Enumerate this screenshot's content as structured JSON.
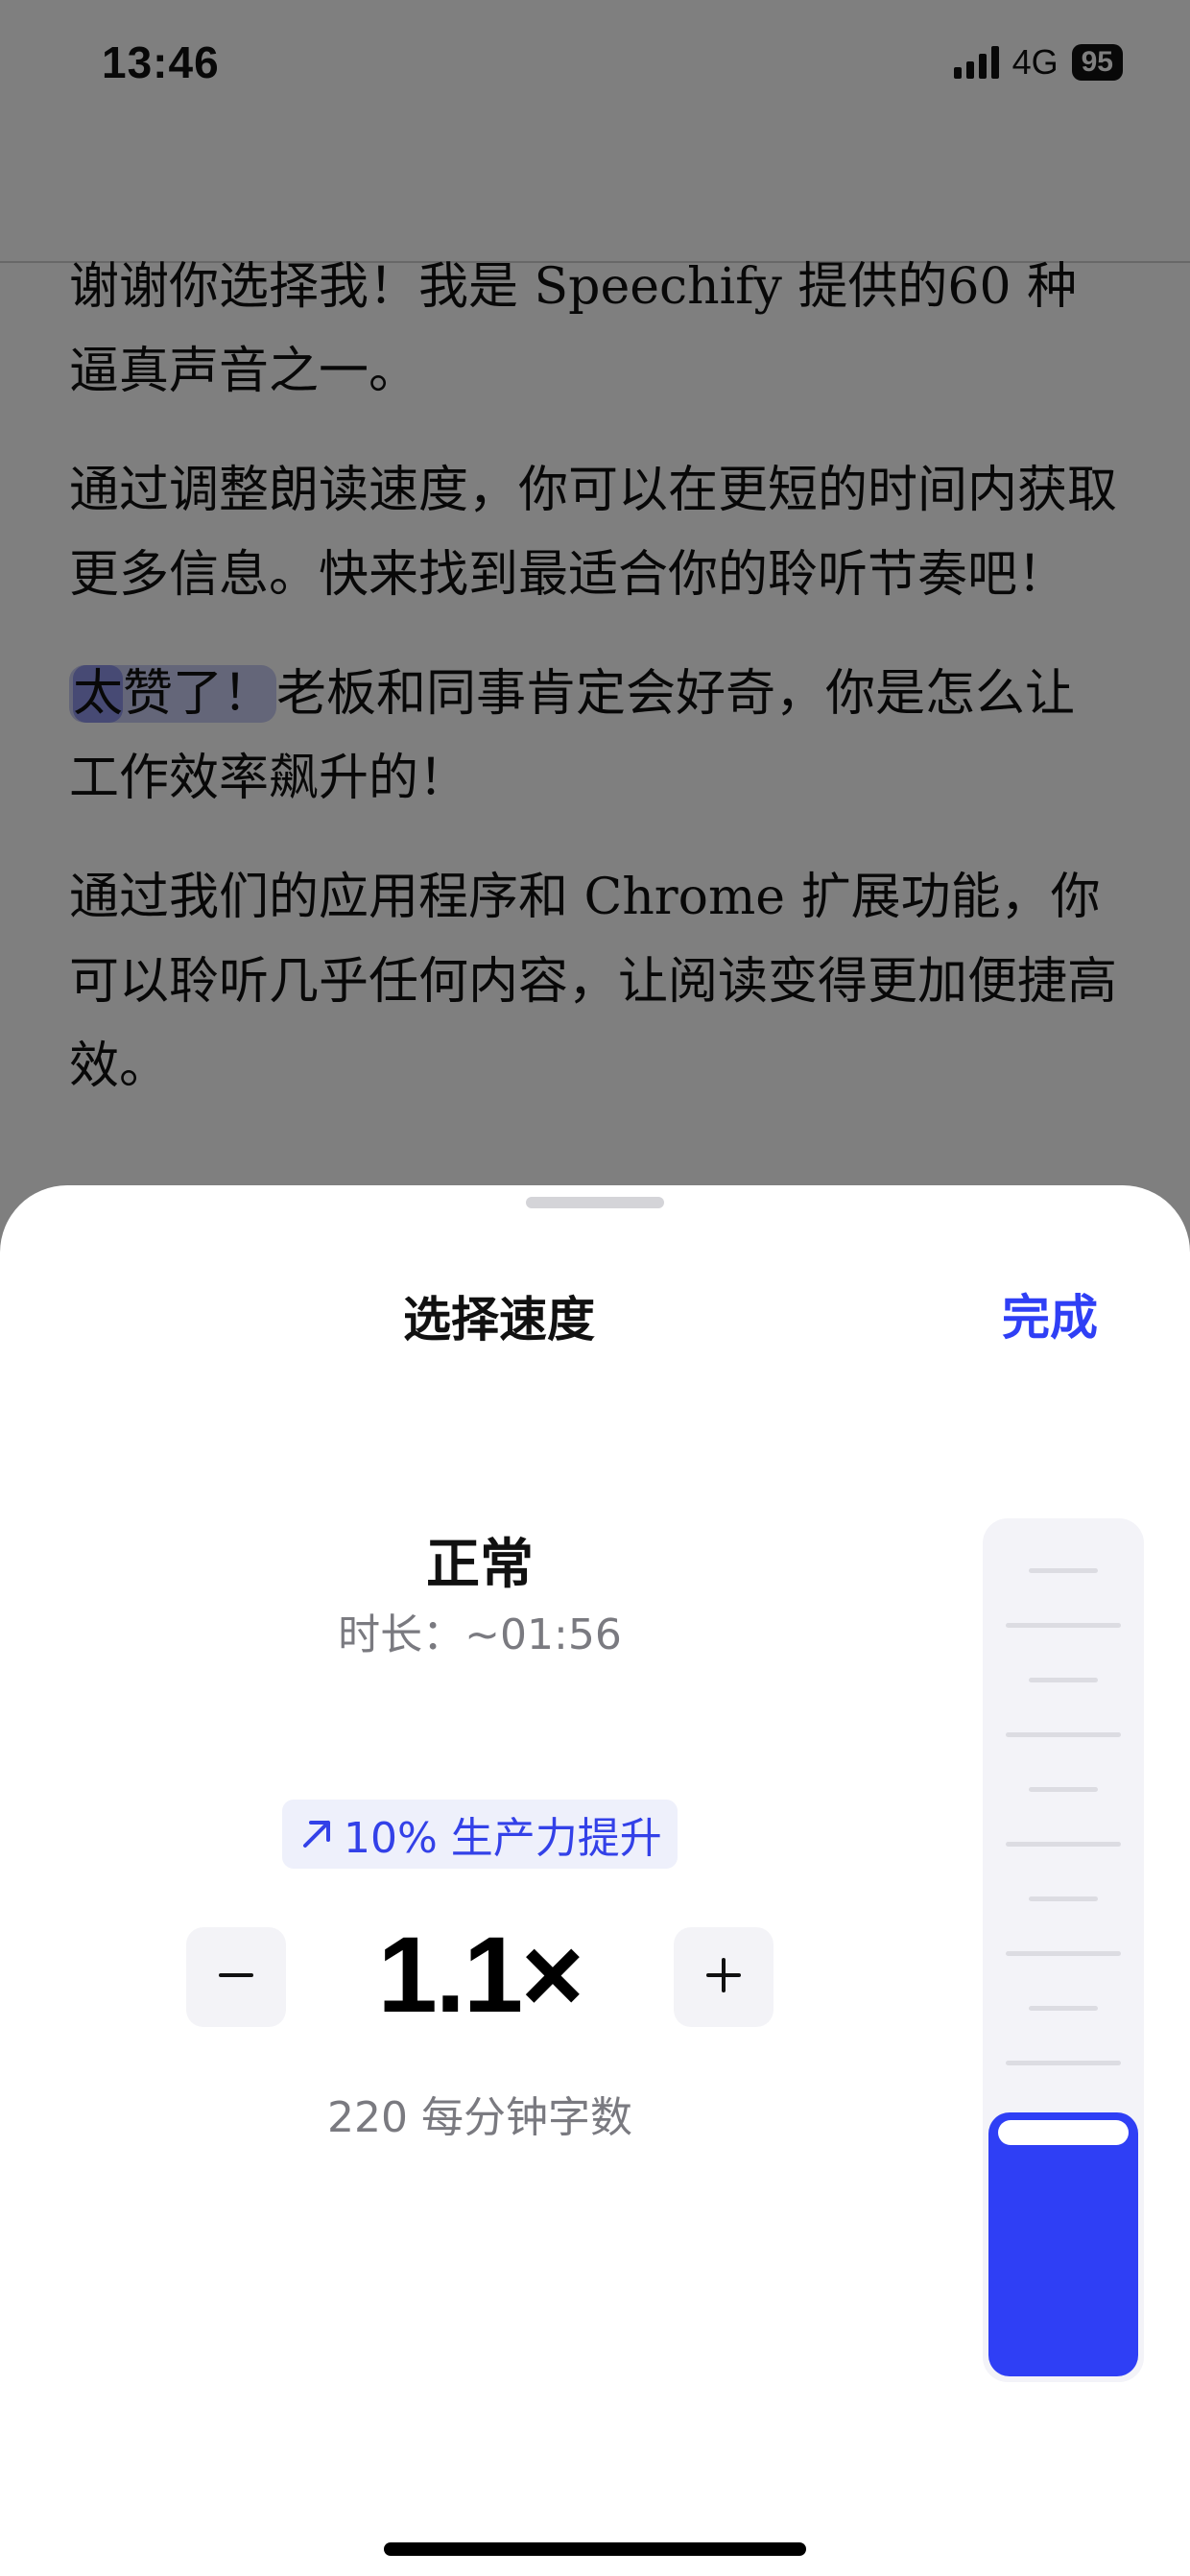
{
  "status": {
    "time": "13:46",
    "network": "4G",
    "battery": "95"
  },
  "reader": {
    "paragraphs": [
      {
        "text": "谢谢你选择我！我是 Speechify 提供的60 种逼真声音之一。"
      },
      {
        "text": "通过调整朗读速度，你可以在更短的时间内获取更多信息。快来找到最适合你的聆听节奏吧！"
      },
      {
        "highlight_word": "太",
        "highlight_rest": "赞了！",
        "rest": "老板和同事肯定会好奇，你是怎么让工作效率飙升的！"
      },
      {
        "text": "通过我们的应用程序和 Chrome 扩展功能，你可以聆听几乎任何内容，让阅读变得更加便捷高效。"
      }
    ]
  },
  "sheet": {
    "title": "选择速度",
    "done_label": "完成",
    "speed_name": "正常",
    "duration": "时长：~01:56",
    "boost": "10% 生产力提升",
    "speed_value": "1.1×",
    "wpm": "220 每分钟字数",
    "slider_level": 0.31,
    "slider_ticks": 10
  },
  "colors": {
    "accent": "#2f3ff5",
    "highlight": "#c9ccf2",
    "highlight_word": "#8e95e8"
  },
  "icons": {
    "boost": "arrow-up-right-icon",
    "minus": "minus-icon",
    "plus": "plus-icon"
  }
}
